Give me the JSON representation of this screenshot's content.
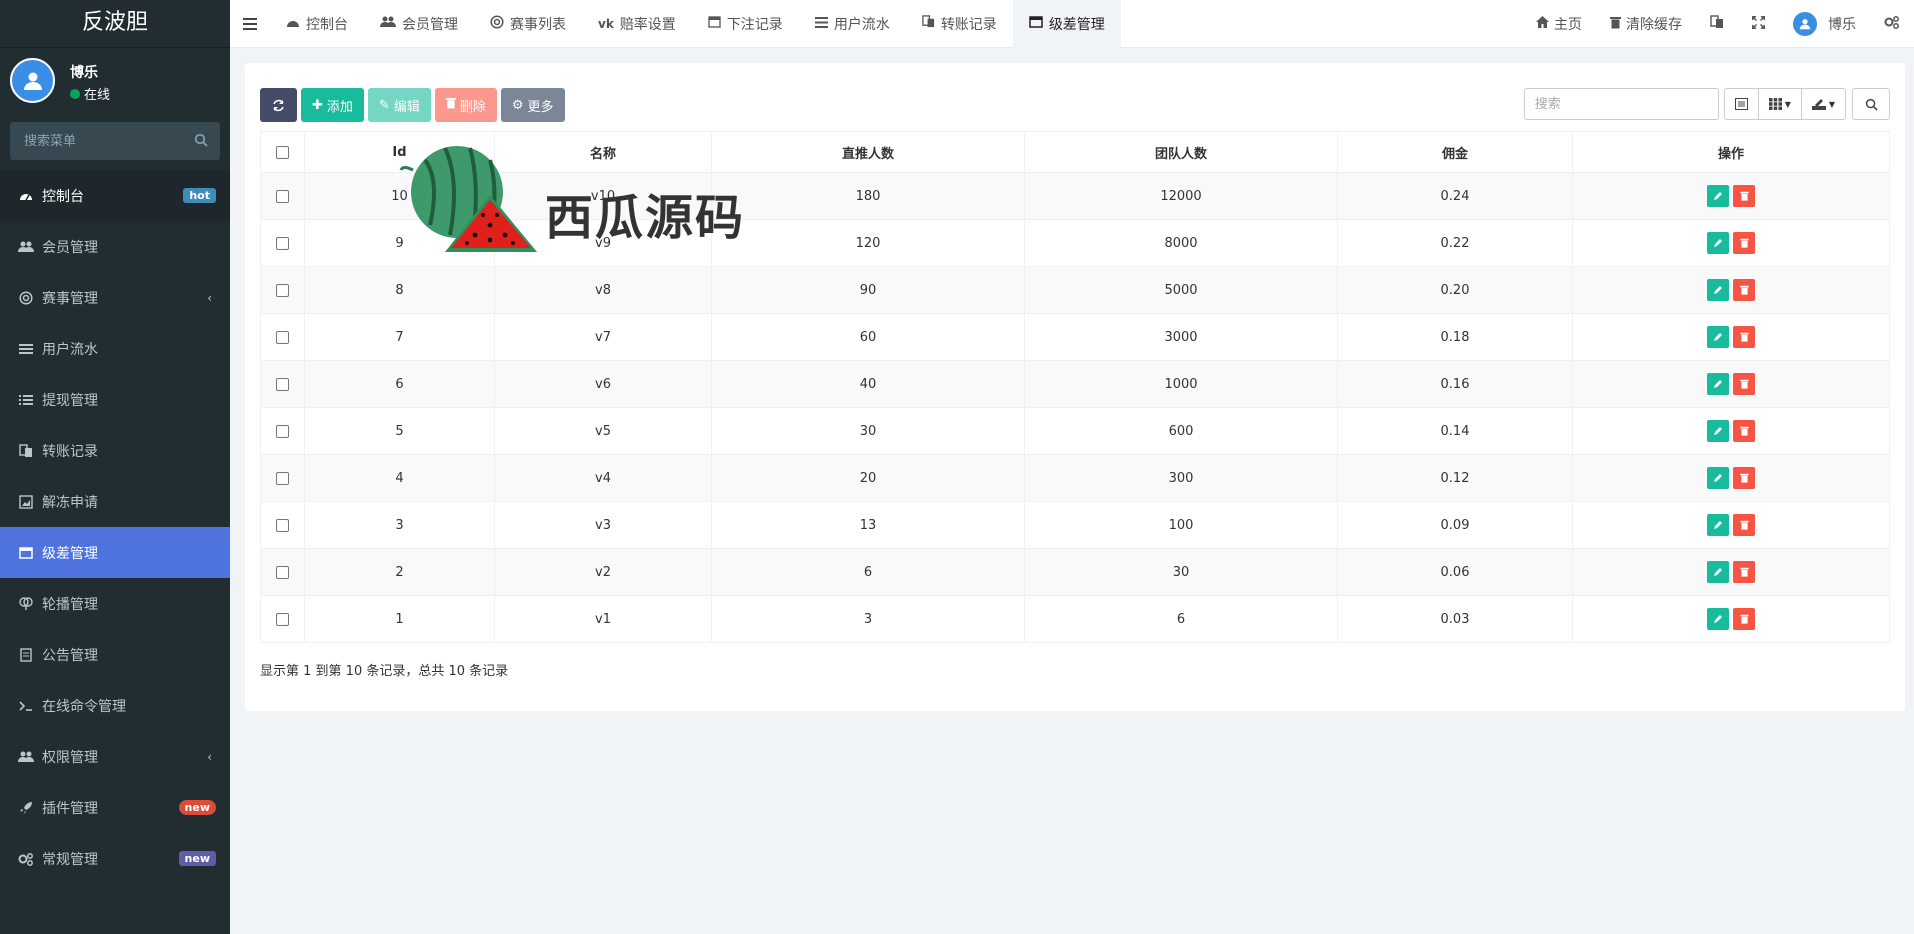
{
  "app": {
    "title": "反波胆"
  },
  "user": {
    "name": "博乐",
    "status": "在线"
  },
  "sidebar": {
    "search_placeholder": "搜索菜单",
    "items": [
      {
        "label": "控制台",
        "icon": "dashboard-icon",
        "badge": "hot"
      },
      {
        "label": "会员管理",
        "icon": "users-icon"
      },
      {
        "label": "赛事管理",
        "icon": "life-ring-icon",
        "chevron": "‹"
      },
      {
        "label": "用户流水",
        "icon": "list-icon"
      },
      {
        "label": "提现管理",
        "icon": "list-ol-icon"
      },
      {
        "label": "转账记录",
        "icon": "exchange-icon"
      },
      {
        "label": "解冻申请",
        "icon": "image-icon"
      },
      {
        "label": "级差管理",
        "icon": "window-icon"
      },
      {
        "label": "轮播管理",
        "icon": "slides-icon"
      },
      {
        "label": "公告管理",
        "icon": "notice-icon"
      },
      {
        "label": "在线命令管理",
        "icon": "terminal-icon"
      },
      {
        "label": "权限管理",
        "icon": "group-icon",
        "chevron": "‹"
      },
      {
        "label": "插件管理",
        "icon": "rocket-icon",
        "badge": "new"
      },
      {
        "label": "常规管理",
        "icon": "cogs-icon",
        "badge": "new"
      }
    ]
  },
  "topbar": {
    "tabs": [
      {
        "label": "控制台",
        "icon": "dashboard-icon"
      },
      {
        "label": "会员管理",
        "icon": "users-icon"
      },
      {
        "label": "赛事列表",
        "icon": "life-ring-icon"
      },
      {
        "label": "赔率设置",
        "icon": "vk-icon"
      },
      {
        "label": "下注记录",
        "icon": "calendar-icon"
      },
      {
        "label": "用户流水",
        "icon": "list-icon"
      },
      {
        "label": "转账记录",
        "icon": "exchange-icon"
      },
      {
        "label": "级差管理",
        "icon": "window-icon"
      }
    ],
    "home_label": "主页",
    "clear_cache_label": "清除缓存",
    "user_label": "博乐"
  },
  "toolbar": {
    "add_label": "添加",
    "edit_label": "编辑",
    "delete_label": "删除",
    "more_label": "更多",
    "search_placeholder": "搜索"
  },
  "table": {
    "headers": {
      "id": "Id",
      "name": "名称",
      "direct": "直推人数",
      "team": "团队人数",
      "commission": "佣金",
      "ops": "操作"
    },
    "rows": [
      {
        "id": "10",
        "name": "v10",
        "direct": "180",
        "team": "12000",
        "commission": "0.24"
      },
      {
        "id": "9",
        "name": "v9",
        "direct": "120",
        "team": "8000",
        "commission": "0.22"
      },
      {
        "id": "8",
        "name": "v8",
        "direct": "90",
        "team": "5000",
        "commission": "0.20"
      },
      {
        "id": "7",
        "name": "v7",
        "direct": "60",
        "team": "3000",
        "commission": "0.18"
      },
      {
        "id": "6",
        "name": "v6",
        "direct": "40",
        "team": "1000",
        "commission": "0.16"
      },
      {
        "id": "5",
        "name": "v5",
        "direct": "30",
        "team": "600",
        "commission": "0.14"
      },
      {
        "id": "4",
        "name": "v4",
        "direct": "20",
        "team": "300",
        "commission": "0.12"
      },
      {
        "id": "3",
        "name": "v3",
        "direct": "13",
        "team": "100",
        "commission": "0.09"
      },
      {
        "id": "2",
        "name": "v2",
        "direct": "6",
        "team": "30",
        "commission": "0.06"
      },
      {
        "id": "1",
        "name": "v1",
        "direct": "3",
        "team": "6",
        "commission": "0.03"
      }
    ],
    "summary": "显示第 1 到第 10 条记录，总共 10 条记录"
  },
  "watermark": {
    "text": "西瓜源码"
  },
  "colors": {
    "sidebar": "#222d32",
    "active": "#4e73df",
    "success": "#18bc9c",
    "danger": "#f75444",
    "primary_dark": "#444c69"
  }
}
